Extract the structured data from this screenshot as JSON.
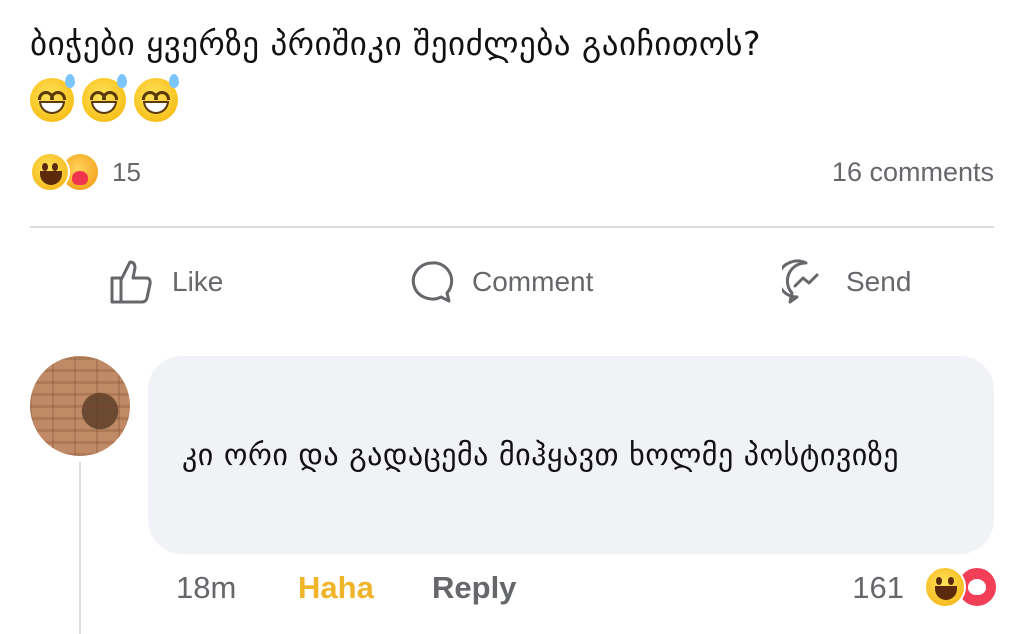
{
  "post": {
    "text": "ბიჭები ყვერზე პრიშიკი შეიძლება გაიჩითოს?",
    "emoji_icons": [
      "grinning-sweat-icon",
      "grinning-sweat-icon",
      "grinning-sweat-icon"
    ]
  },
  "reactions": {
    "icons": [
      "haha-reaction-icon",
      "care-reaction-icon"
    ],
    "count": "15"
  },
  "comments_count": "16 comments",
  "actions": {
    "like": "Like",
    "comment": "Comment",
    "send": "Send"
  },
  "comment": {
    "text": "კი ორი და გადაცემა მიჰყავთ ხოლმე პოსტივიზე",
    "time": "18m",
    "haha_label": "Haha",
    "reply_label": "Reply",
    "reaction_count": "161",
    "reaction_icons": [
      "haha-reaction-icon",
      "love-reaction-icon"
    ]
  },
  "colors": {
    "muted_text": "#65676b",
    "haha_accent": "#f0b429",
    "bubble_bg": "#f0f2f5",
    "love": "#f33e58"
  }
}
